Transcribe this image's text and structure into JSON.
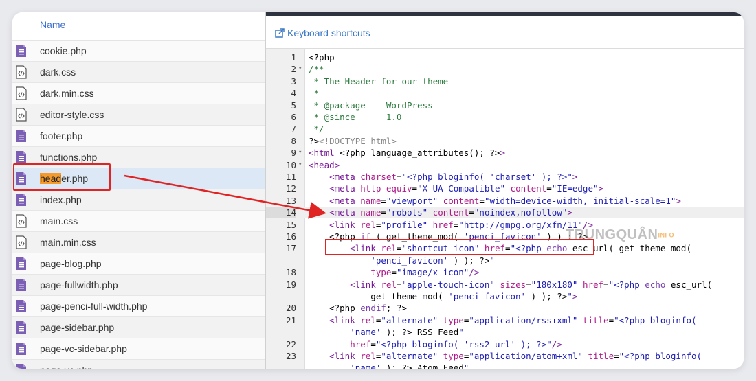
{
  "file_list": {
    "header": "Name",
    "files": [
      {
        "name": "cookie.php",
        "type": "doc"
      },
      {
        "name": "dark.css",
        "type": "code"
      },
      {
        "name": "dark.min.css",
        "type": "code"
      },
      {
        "name": "editor-style.css",
        "type": "code"
      },
      {
        "name": "footer.php",
        "type": "doc"
      },
      {
        "name": "functions.php",
        "type": "doc"
      },
      {
        "name": "header.php",
        "type": "doc",
        "highlight": "head",
        "rest": "er.php",
        "selected": true
      },
      {
        "name": "index.php",
        "type": "doc"
      },
      {
        "name": "main.css",
        "type": "code"
      },
      {
        "name": "main.min.css",
        "type": "code"
      },
      {
        "name": "page-blog.php",
        "type": "doc"
      },
      {
        "name": "page-fullwidth.php",
        "type": "doc"
      },
      {
        "name": "page-penci-full-width.php",
        "type": "doc"
      },
      {
        "name": "page-sidebar.php",
        "type": "doc"
      },
      {
        "name": "page-vc-sidebar.php",
        "type": "doc"
      },
      {
        "name": "page-vc.php",
        "type": "doc"
      }
    ]
  },
  "editor": {
    "keyboard_shortcuts": "Keyboard shortcuts",
    "watermark": "TRUNGQUÂN",
    "watermark_tag": "INFO",
    "lines": [
      {
        "n": "1",
        "tokens": [
          [
            "c",
            "<?php"
          ]
        ]
      },
      {
        "n": "2",
        "fold": true,
        "tokens": [
          [
            "com",
            "/**"
          ]
        ]
      },
      {
        "n": "3",
        "tokens": [
          [
            "com",
            " * The Header for our theme"
          ]
        ]
      },
      {
        "n": "4",
        "tokens": [
          [
            "com",
            " *"
          ]
        ]
      },
      {
        "n": "5",
        "tokens": [
          [
            "com",
            " * @package    WordPress"
          ]
        ]
      },
      {
        "n": "6",
        "tokens": [
          [
            "com",
            " * @since      1.0"
          ]
        ]
      },
      {
        "n": "7",
        "tokens": [
          [
            "com",
            " */"
          ]
        ]
      },
      {
        "n": "8",
        "tokens": [
          [
            "c",
            "?>"
          ],
          [
            "dt",
            "<!DOCTYPE html>"
          ]
        ]
      },
      {
        "n": "9",
        "fold": true,
        "tokens": [
          [
            "tag",
            "<html"
          ],
          [
            "c",
            " <?php language_attributes(); ?>"
          ],
          [
            "tag",
            ">"
          ]
        ]
      },
      {
        "n": "10",
        "fold": true,
        "tokens": [
          [
            "tag",
            "<head>"
          ]
        ]
      },
      {
        "n": "11",
        "tokens": [
          [
            "c",
            "    "
          ],
          [
            "tag",
            "<meta"
          ],
          [
            "c",
            " "
          ],
          [
            "attr",
            "charset"
          ],
          [
            "c",
            "="
          ],
          [
            "str",
            "\"<?php bloginfo( 'charset' ); ?>\""
          ],
          [
            "tag",
            ">"
          ]
        ]
      },
      {
        "n": "12",
        "tokens": [
          [
            "c",
            "    "
          ],
          [
            "tag",
            "<meta"
          ],
          [
            "c",
            " "
          ],
          [
            "attr",
            "http-equiv"
          ],
          [
            "c",
            "="
          ],
          [
            "str",
            "\"X-UA-Compatible\""
          ],
          [
            "c",
            " "
          ],
          [
            "attr",
            "content"
          ],
          [
            "c",
            "="
          ],
          [
            "str",
            "\"IE=edge\""
          ],
          [
            "tag",
            ">"
          ]
        ]
      },
      {
        "n": "13",
        "tokens": [
          [
            "c",
            "    "
          ],
          [
            "tag",
            "<meta"
          ],
          [
            "c",
            " "
          ],
          [
            "attr",
            "name"
          ],
          [
            "c",
            "="
          ],
          [
            "str",
            "\"viewport\""
          ],
          [
            "c",
            " "
          ],
          [
            "attr",
            "content"
          ],
          [
            "c",
            "="
          ],
          [
            "str",
            "\"width=device-width, initial-scale=1\""
          ],
          [
            "tag",
            ">"
          ]
        ]
      },
      {
        "n": "14",
        "active": true,
        "tokens": [
          [
            "c",
            "    "
          ],
          [
            "tag",
            "<meta"
          ],
          [
            "c",
            " "
          ],
          [
            "attr",
            "name"
          ],
          [
            "c",
            "="
          ],
          [
            "str",
            "\"robots\""
          ],
          [
            "c",
            " "
          ],
          [
            "attr",
            "content"
          ],
          [
            "c",
            "="
          ],
          [
            "str",
            "\"noindex,nofollow\""
          ],
          [
            "tag",
            ">"
          ]
        ]
      },
      {
        "n": "15",
        "tokens": [
          [
            "c",
            "    "
          ],
          [
            "tag",
            "<link"
          ],
          [
            "c",
            " "
          ],
          [
            "attr",
            "rel"
          ],
          [
            "c",
            "="
          ],
          [
            "str",
            "\"profile\""
          ],
          [
            "c",
            " "
          ],
          [
            "attr",
            "href"
          ],
          [
            "c",
            "="
          ],
          [
            "str",
            "\"http://gmpg.org/xfn/11\""
          ],
          [
            "tag",
            "/>"
          ]
        ]
      },
      {
        "n": "16",
        "tokens": [
          [
            "c",
            "    <?php "
          ],
          [
            "kw",
            "if"
          ],
          [
            "c",
            " ( get_theme_mod( "
          ],
          [
            "str",
            "'penci_favicon'"
          ],
          [
            "c",
            " ) ) : ?>"
          ]
        ]
      },
      {
        "n": "17",
        "tokens": [
          [
            "c",
            "        "
          ],
          [
            "tag",
            "<link"
          ],
          [
            "c",
            " "
          ],
          [
            "attr",
            "rel"
          ],
          [
            "c",
            "="
          ],
          [
            "str",
            "\"shortcut icon\""
          ],
          [
            "c",
            " "
          ],
          [
            "attr",
            "href"
          ],
          [
            "c",
            "="
          ],
          [
            "str",
            "\"<?php "
          ],
          [
            "kw",
            "echo"
          ],
          [
            "c",
            " esc_url( get_theme_mod("
          ]
        ]
      },
      {
        "n": "",
        "tokens": [
          [
            "c",
            "            "
          ],
          [
            "str",
            "'penci_favicon'"
          ],
          [
            "c",
            " ) ); ?>"
          ],
          [
            "str",
            "\""
          ]
        ]
      },
      {
        "n": "18",
        "tokens": [
          [
            "c",
            "            "
          ],
          [
            "attr",
            "type"
          ],
          [
            "c",
            "="
          ],
          [
            "str",
            "\"image/x-icon\""
          ],
          [
            "tag",
            "/>"
          ]
        ]
      },
      {
        "n": "19",
        "tokens": [
          [
            "c",
            "        "
          ],
          [
            "tag",
            "<link"
          ],
          [
            "c",
            " "
          ],
          [
            "attr",
            "rel"
          ],
          [
            "c",
            "="
          ],
          [
            "str",
            "\"apple-touch-icon\""
          ],
          [
            "c",
            " "
          ],
          [
            "attr",
            "sizes"
          ],
          [
            "c",
            "="
          ],
          [
            "str",
            "\"180x180\""
          ],
          [
            "c",
            " "
          ],
          [
            "attr",
            "href"
          ],
          [
            "c",
            "="
          ],
          [
            "str",
            "\"<?php "
          ],
          [
            "kw",
            "echo"
          ],
          [
            "c",
            " esc_url("
          ]
        ]
      },
      {
        "n": "",
        "tokens": [
          [
            "c",
            "            get_theme_mod( "
          ],
          [
            "str",
            "'penci_favicon'"
          ],
          [
            "c",
            " ) ); ?>"
          ],
          [
            "str",
            "\""
          ],
          [
            "tag",
            ">"
          ]
        ]
      },
      {
        "n": "20",
        "tokens": [
          [
            "c",
            "    <?php "
          ],
          [
            "kw",
            "endif"
          ],
          [
            "c",
            "; ?>"
          ]
        ]
      },
      {
        "n": "21",
        "tokens": [
          [
            "c",
            "    "
          ],
          [
            "tag",
            "<link"
          ],
          [
            "c",
            " "
          ],
          [
            "attr",
            "rel"
          ],
          [
            "c",
            "="
          ],
          [
            "str",
            "\"alternate\""
          ],
          [
            "c",
            " "
          ],
          [
            "attr",
            "type"
          ],
          [
            "c",
            "="
          ],
          [
            "str",
            "\"application/rss+xml\""
          ],
          [
            "c",
            " "
          ],
          [
            "attr",
            "title"
          ],
          [
            "c",
            "="
          ],
          [
            "str",
            "\"<?php bloginfo("
          ]
        ]
      },
      {
        "n": "",
        "tokens": [
          [
            "c",
            "        "
          ],
          [
            "str",
            "'name'"
          ],
          [
            "c",
            " ); ?> RSS Feed"
          ],
          [
            "str",
            "\""
          ]
        ]
      },
      {
        "n": "22",
        "tokens": [
          [
            "c",
            "        "
          ],
          [
            "attr",
            "href"
          ],
          [
            "c",
            "="
          ],
          [
            "str",
            "\"<?php bloginfo( 'rss2_url' ); ?>\""
          ],
          [
            "tag",
            "/>"
          ]
        ]
      },
      {
        "n": "23",
        "tokens": [
          [
            "c",
            "    "
          ],
          [
            "tag",
            "<link"
          ],
          [
            "c",
            " "
          ],
          [
            "attr",
            "rel"
          ],
          [
            "c",
            "="
          ],
          [
            "str",
            "\"alternate\""
          ],
          [
            "c",
            " "
          ],
          [
            "attr",
            "type"
          ],
          [
            "c",
            "="
          ],
          [
            "str",
            "\"application/atom+xml\""
          ],
          [
            "c",
            " "
          ],
          [
            "attr",
            "title"
          ],
          [
            "c",
            "="
          ],
          [
            "str",
            "\"<?php bloginfo("
          ]
        ]
      },
      {
        "n": "",
        "tokens": [
          [
            "c",
            "        "
          ],
          [
            "str",
            "'name'"
          ],
          [
            "c",
            " ); ?> Atom Feed"
          ],
          [
            "str",
            "\""
          ]
        ]
      }
    ]
  }
}
